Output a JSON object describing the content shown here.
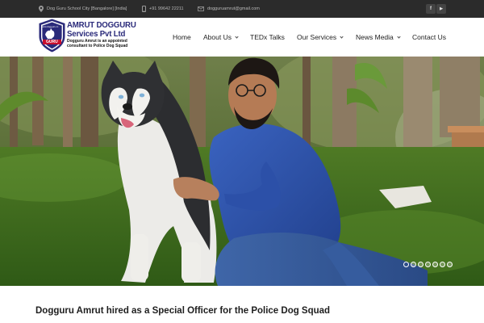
{
  "topbar": {
    "address": "Dog Guru School City [Bangalore] [India]",
    "phone": "+91 99642 22211",
    "email": "dogguruamrut@gmail.com",
    "social": [
      {
        "icon": "facebook-icon",
        "glyph": "f"
      },
      {
        "icon": "youtube-icon",
        "glyph": "▶"
      }
    ]
  },
  "logo": {
    "line1": "AMRUT DOGGURU",
    "line2": "Services Pvt Ltd",
    "tagline": "Dogguru Amrut is an appointed consultant to Police Dog Squad",
    "badge_top": "www.dogguru.in",
    "badge_word": "GURU"
  },
  "nav": {
    "items": [
      {
        "label": "Home",
        "dropdown": false
      },
      {
        "label": "About Us",
        "dropdown": true
      },
      {
        "label": "TEDx Talks",
        "dropdown": false
      },
      {
        "label": "Our Services",
        "dropdown": true
      },
      {
        "label": "News Media",
        "dropdown": true
      },
      {
        "label": "Contact Us",
        "dropdown": false
      }
    ]
  },
  "hero": {
    "slide_count": 7,
    "active_slide": 1
  },
  "post": {
    "title": "Dogguru Amrut hired as a Special Officer for the Police Dog Squad"
  },
  "colors": {
    "topbar_bg": "#2b2b2b",
    "brand_navy": "#2a2a7a",
    "shirt_blue": "#2c4fa8"
  }
}
